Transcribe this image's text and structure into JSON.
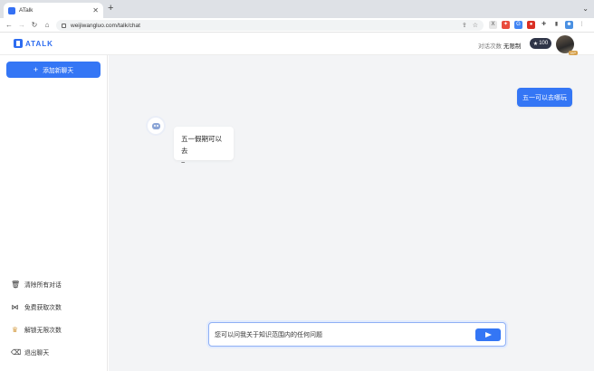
{
  "browser": {
    "tab_title": "ATalk",
    "tab_close": "✕",
    "new_tab": "+",
    "tab_menu": "⌄",
    "url": "weijiwangluo.com/talk/chat",
    "nav": {
      "back": "←",
      "forward": "→",
      "reload": "↻",
      "home": "⌂"
    },
    "omnibox_icons": {
      "share": "⇪",
      "star": "☆"
    },
    "extensions": [
      {
        "name": "ext-x",
        "glyph": "X",
        "color": "#e6e6e6",
        "text": "#555"
      },
      {
        "name": "ext-colorful",
        "glyph": "✦",
        "color": "#e94b3c",
        "text": "#fff"
      },
      {
        "name": "ext-translate",
        "glyph": "G",
        "color": "#4285f4",
        "text": "#fff"
      },
      {
        "name": "ext-red",
        "glyph": "●",
        "color": "#d93025",
        "text": "#fff"
      },
      {
        "name": "ext-puzzle",
        "glyph": "✚",
        "color": "#ffffff",
        "text": "#555"
      },
      {
        "name": "ext-sidepanel",
        "glyph": "▮",
        "color": "#ffffff",
        "text": "#555"
      },
      {
        "name": "ext-profile",
        "glyph": "☻",
        "color": "#4a90e2",
        "text": "#fff"
      },
      {
        "name": "ext-menu",
        "glyph": "⋮",
        "color": "#ffffff",
        "text": "#555"
      }
    ]
  },
  "header": {
    "logo_text": "ATALK",
    "quota_label": "对话次数",
    "quota_value": "无限制",
    "points_icon": "★",
    "points_value": "100",
    "vip_badge": "VIP"
  },
  "sidebar": {
    "new_chat_icon": "+",
    "new_chat_label": "添加新聊天",
    "items": [
      {
        "icon": "🗑",
        "label": "清除所有对话"
      },
      {
        "icon": "⋈",
        "label": "免费获取次数"
      },
      {
        "icon": "♛",
        "label": "解锁无限次数"
      },
      {
        "icon": "⌫",
        "label": "退出聊天"
      }
    ]
  },
  "chat": {
    "user_message": "五一可以去哪玩",
    "bot_message_line1": "五一假期可以去",
    "bot_message_line2": "~"
  },
  "composer": {
    "placeholder": "您可以问我关于知识范围内的任何问题"
  },
  "colors": {
    "accent": "#3476f5",
    "sidebar_bg": "#ffffff",
    "main_bg": "#f3f4f6"
  }
}
